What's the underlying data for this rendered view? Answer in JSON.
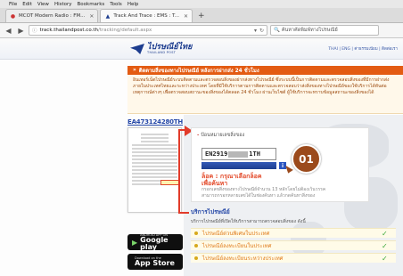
{
  "browser": {
    "menu": [
      "File",
      "Edit",
      "View",
      "History",
      "Bookmarks",
      "Tools",
      "Help"
    ],
    "tabs": [
      {
        "label": "MCOT Modern Radio : FM...",
        "active": false
      },
      {
        "label": "Track And Trace : EMS : T...",
        "active": true
      }
    ],
    "url_host": "track.thailandpost.co.th",
    "url_path": "/tracking/default.aspx",
    "search_placeholder": "ค้นหาคัดพิมพ์ทางไปรษณีย์"
  },
  "site": {
    "logo_text": "ไปรษณีย์ไทย",
    "logo_sub": "THAILAND POST",
    "header_links": "THAI | ENG | ค่าธรรมเนียม | ติดต่อเรา",
    "banner_title": "ติดตามสิ่งของทางไปรษณีย์ หลังการฝากส่ง 24 ชั่วโมง",
    "intro": "อินเทอร์เน็ตไปรษณีย์ระบบติดตามและตรวจสอบสิ่งของฝากส่งทางไปรษณีย์ ซึ่งระบบนี้เป็นการติดตามและตรวจสอบสิ่งของที่มีการฝากส่งภายในประเทศไทยและระหว่างประเทศ โดยที่มีใช้บริการตามการติดตามและตรวจสอบว่าส่งสิ่งของทางไปรษณีย์ของใช้บริการได้ทันต่อเหตุการณ์ต่างๆ เพื่อตรวจสอบสถานะของสิ่งของได้ตลอด 24 ชั่วโมง ผ่านเว็บไซต์ ผู้ใช้บริการจะทราบข้อมูลสถานะของสิ่งของได้"
  },
  "receipt": {
    "tracking_number": "EA473124280TH"
  },
  "stores": {
    "google_small": "ANDROID APP ON",
    "google_big": "Google play",
    "apple_small": "Download on the",
    "apple_big": "App Store"
  },
  "form": {
    "legend": "ป้อนหมายเลขสิ่งของ",
    "input_prefix": "EN2919",
    "input_suffix": "1TH",
    "captcha_line1": "ล็อค : กรุณาเลือกล็อค",
    "captcha_line2": "เพื่อค้นหา",
    "help_line1": "กรอกเลขสิ่งของทางไปรษณีย์จำนวน 13 หลักโดยไม่ต้องเว้นวรรค",
    "help_line2": "สามารถกรอกหลายเลขได้ในช่องค้นหา แล้วกดค้นหาสิ่งของ"
  },
  "callout": {
    "label": "01"
  },
  "services": {
    "title": "บริการไปรษณีย์",
    "desc": "บริการไปรษณีย์ที่เปิดให้บริการสามารถตรวจสอบสิ่งของ ดังนี้",
    "items": [
      {
        "label": "ไปรษณีย์ด่วนพิเศษในประเทศ"
      },
      {
        "label": "ไปรษณีย์ลงทะเบียนในประเทศ"
      },
      {
        "label": "ไปรษณีย์ลงทะเบียนระหว่างประเทศ"
      }
    ]
  },
  "colors": {
    "banner": "#e35b12",
    "brand_blue": "#2447a7",
    "callout": "#9b4a1c",
    "highlight_red": "#e23b2a"
  }
}
